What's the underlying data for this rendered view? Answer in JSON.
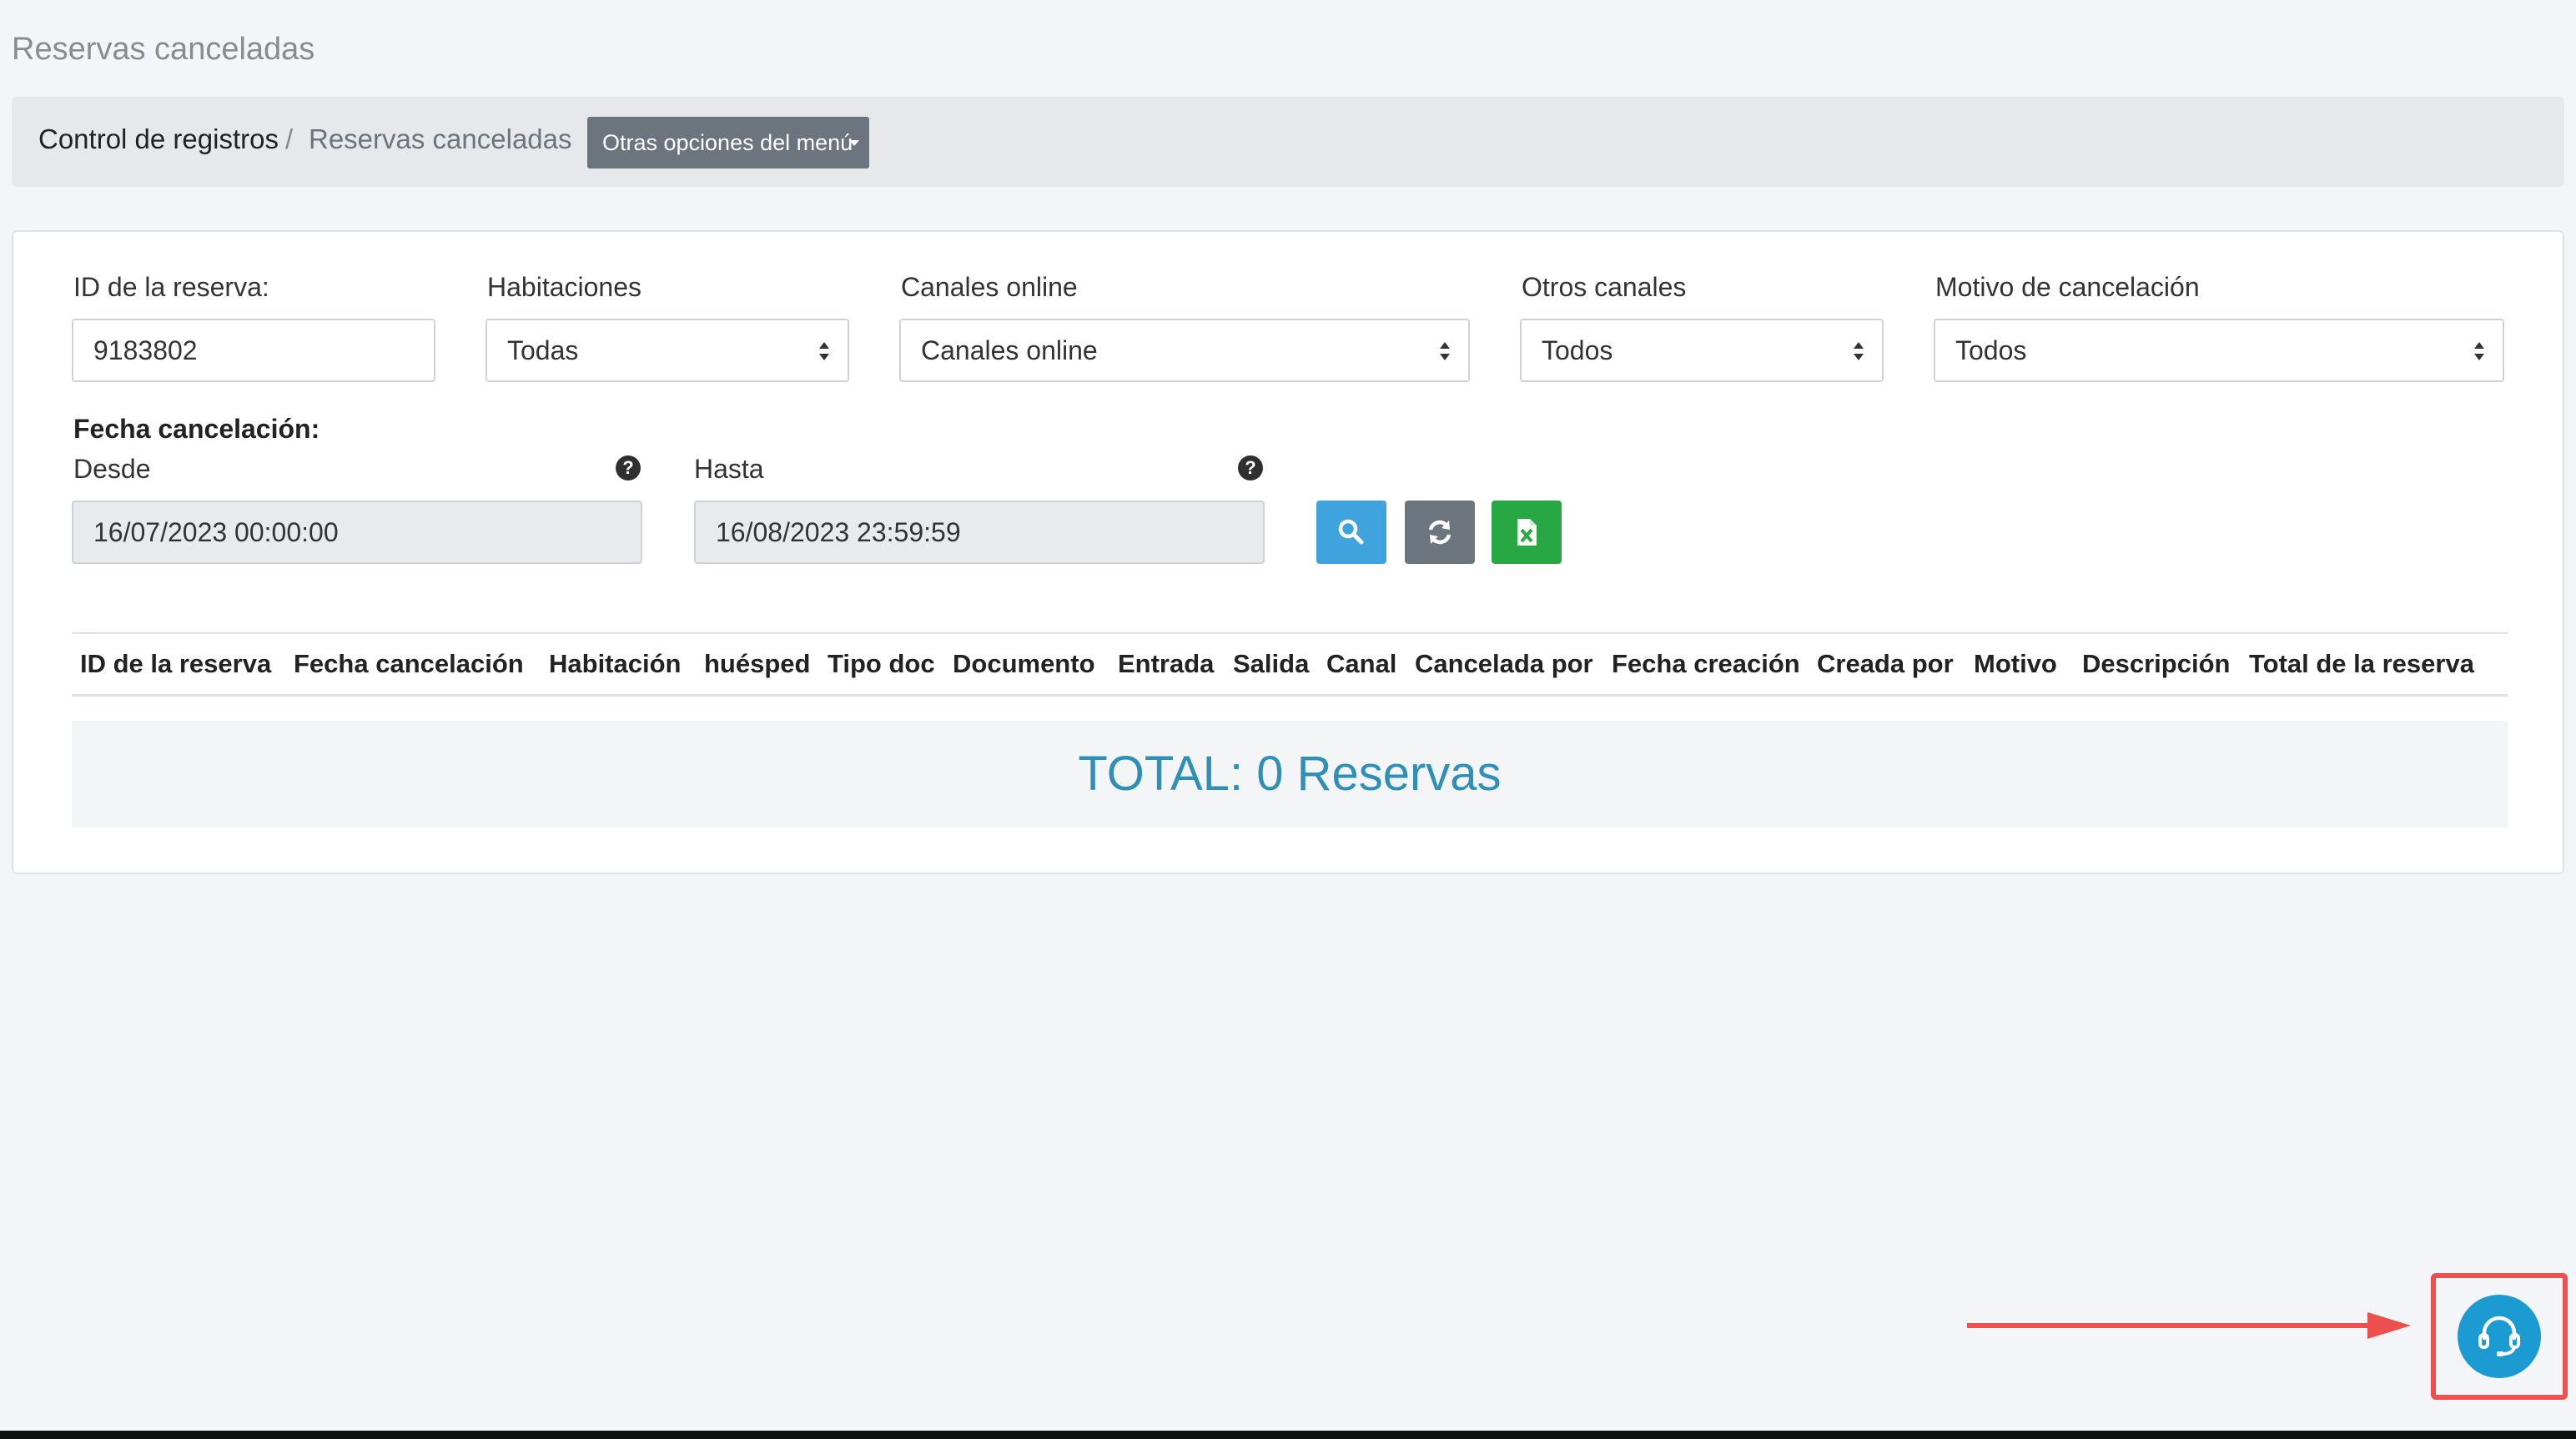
{
  "page": {
    "title": "Reservas canceladas"
  },
  "breadcrumb": {
    "items": [
      "Control de registros",
      "Reservas canceladas"
    ],
    "separator": "/",
    "menu_button": "Otras opciones del menú"
  },
  "filters": {
    "reservation_id": {
      "label": "ID de la reserva:",
      "value": "9183802"
    },
    "rooms": {
      "label": "Habitaciones",
      "value": "Todas"
    },
    "online_channels": {
      "label": "Canales online",
      "value": "Canales online"
    },
    "other_channels": {
      "label": "Otros canales",
      "value": "Todos"
    },
    "cancel_reason": {
      "label": "Motivo de cancelación",
      "value": "Todos"
    },
    "cancel_date": {
      "label": "Fecha cancelación:",
      "from": {
        "label": "Desde",
        "value": "16/07/2023 00:00:00"
      },
      "to": {
        "label": "Hasta",
        "value": "16/08/2023 23:59:59"
      }
    },
    "help_glyph": "?"
  },
  "actions": {
    "search": {
      "icon": "search-icon",
      "color": "#3fa3de"
    },
    "refresh": {
      "icon": "refresh-icon",
      "color": "#6c757d"
    },
    "excel": {
      "icon": "excel-file-icon",
      "color": "#28a745"
    }
  },
  "table": {
    "columns": [
      "ID de la reserva",
      "Fecha cancelación",
      "Habitación",
      "huésped",
      "Tipo doc",
      "Documento",
      "Entrada",
      "Salida",
      "Canal",
      "Cancelada por",
      "Fecha creación",
      "Creada por",
      "Motivo",
      "Descripción",
      "Total de la reserva"
    ],
    "rows": []
  },
  "summary": {
    "total_text": "TOTAL: 0 Reservas"
  },
  "support": {
    "icon": "headset-icon",
    "color": "#1c9bd3",
    "annotation_color": "#ee4f4f"
  }
}
